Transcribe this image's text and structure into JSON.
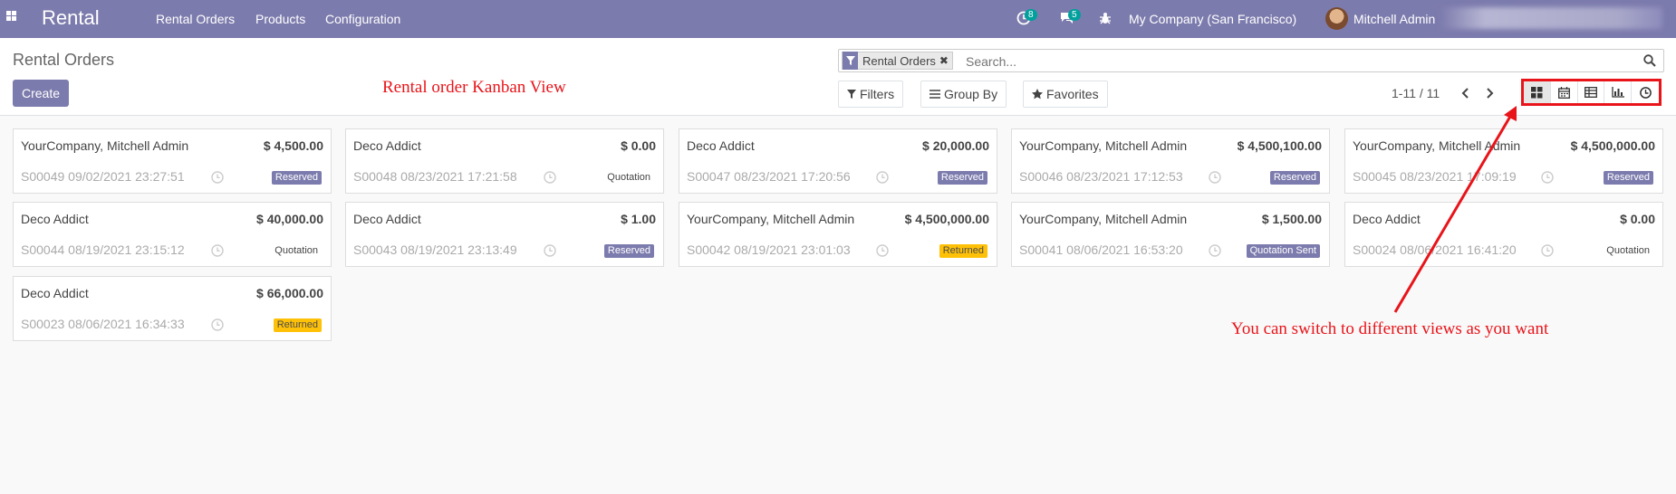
{
  "navbar": {
    "brand": "Rental",
    "menu": [
      "Rental Orders",
      "Products",
      "Configuration"
    ],
    "activities_count": "8",
    "messages_count": "5",
    "company": "My Company (San Francisco)",
    "user": "Mitchell Admin"
  },
  "control": {
    "breadcrumb": "Rental Orders",
    "create_label": "Create",
    "facet_label": "Rental Orders",
    "search_placeholder": "Search...",
    "filters_label": "Filters",
    "groupby_label": "Group By",
    "favorites_label": "Favorites",
    "pager": "1-11 / 11",
    "views": [
      "kanban-icon",
      "calendar-icon",
      "list-icon",
      "graph-icon",
      "activity-icon"
    ]
  },
  "annotations": {
    "title": "Rental order Kanban View",
    "note": "You can switch to different views as you want",
    "color": "#e8141a"
  },
  "colors": {
    "brand": "#7c7bad",
    "returned": "#ffc107"
  },
  "cards": [
    {
      "customer": "YourCompany, Mitchell Admin",
      "amount": "$ 4,500.00",
      "ref": "S00049 09/02/2021 23:27:51",
      "status": "Reserved",
      "kind": "reserved"
    },
    {
      "customer": "Deco Addict",
      "amount": "$ 0.00",
      "ref": "S00048 08/23/2021 17:21:58",
      "status": "Quotation",
      "kind": "quotation"
    },
    {
      "customer": "Deco Addict",
      "amount": "$ 20,000.00",
      "ref": "S00047 08/23/2021 17:20:56",
      "status": "Reserved",
      "kind": "reserved"
    },
    {
      "customer": "YourCompany, Mitchell Admin",
      "amount": "$ 4,500,100.00",
      "ref": "S00046 08/23/2021 17:12:53",
      "status": "Reserved",
      "kind": "reserved"
    },
    {
      "customer": "YourCompany, Mitchell Admin",
      "amount": "$ 4,500,000.00",
      "ref": "S00045 08/23/2021 17:09:19",
      "status": "Reserved",
      "kind": "reserved"
    },
    {
      "customer": "Deco Addict",
      "amount": "$ 40,000.00",
      "ref": "S00044 08/19/2021 23:15:12",
      "status": "Quotation",
      "kind": "quotation"
    },
    {
      "customer": "Deco Addict",
      "amount": "$ 1.00",
      "ref": "S00043 08/19/2021 23:13:49",
      "status": "Reserved",
      "kind": "reserved"
    },
    {
      "customer": "YourCompany, Mitchell Admin",
      "amount": "$ 4,500,000.00",
      "ref": "S00042 08/19/2021 23:01:03",
      "status": "Returned",
      "kind": "returned"
    },
    {
      "customer": "YourCompany, Mitchell Admin",
      "amount": "$ 1,500.00",
      "ref": "S00041 08/06/2021 16:53:20",
      "status": "Quotation Sent",
      "kind": "sent"
    },
    {
      "customer": "Deco Addict",
      "amount": "$ 0.00",
      "ref": "S00024 08/06/2021 16:41:20",
      "status": "Quotation",
      "kind": "quotation"
    },
    {
      "customer": "Deco Addict",
      "amount": "$ 66,000.00",
      "ref": "S00023 08/06/2021 16:34:33",
      "status": "Returned",
      "kind": "returned"
    }
  ]
}
